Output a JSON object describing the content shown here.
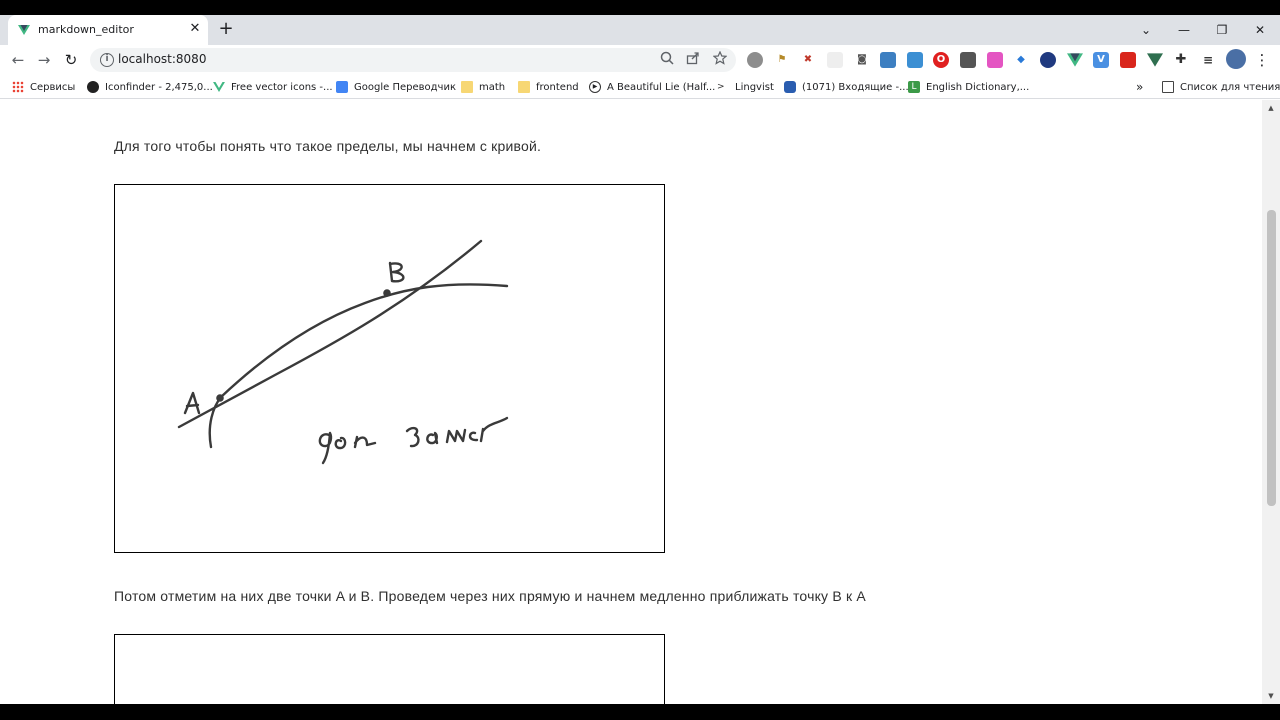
{
  "tab": {
    "title": "markdown_editor",
    "close": "✕",
    "new_tab": "+"
  },
  "window": {
    "minimize": "—",
    "restore": "❐",
    "close": "✕",
    "tab_search": "⌄"
  },
  "toolbar": {
    "back": "←",
    "forward": "→",
    "reload": "↻",
    "url": "localhost:8080",
    "zoom_icon": "zoom-icon",
    "share_icon": "share-icon",
    "star_icon": "star-icon",
    "menu": "⋮"
  },
  "bookmarks": {
    "items": [
      {
        "label": "Сервисы",
        "icon": "apps-grid-icon"
      },
      {
        "label": "Iconfinder - 2,475,0...",
        "icon": "iconfinder-icon"
      },
      {
        "label": "Free vector icons -...",
        "icon": "vue-icon"
      },
      {
        "label": "Google Переводчик",
        "icon": "translate-icon"
      },
      {
        "label": "math",
        "icon": "folder-icon"
      },
      {
        "label": "frontend",
        "icon": "folder-icon"
      },
      {
        "label": "A Beautiful Lie (Half...",
        "icon": "play-icon"
      },
      {
        "label": "Lingvist",
        "icon": "lingvist-icon"
      },
      {
        "label": "(1071) Входящие -...",
        "icon": "mail-icon"
      },
      {
        "label": "English Dictionary,...",
        "icon": "dictionary-icon"
      }
    ],
    "more": "»",
    "reading_list": "Список для чтения"
  },
  "content": {
    "paragraph1": "Для того чтобы понять что такое пределы, мы начнем с кривой.",
    "figure1": {
      "label_a": "A",
      "label_b": "B",
      "handwriting": "доп замет"
    },
    "paragraph2": "Потом отметим на них две точки A и B. Проведем через них прямую и начнем медленно приближать точку B к A"
  },
  "colors": {
    "tab_strip": "#dee1e6",
    "omnibox": "#f1f3f4",
    "text": "#303030",
    "ink": "#3a3a3a"
  }
}
